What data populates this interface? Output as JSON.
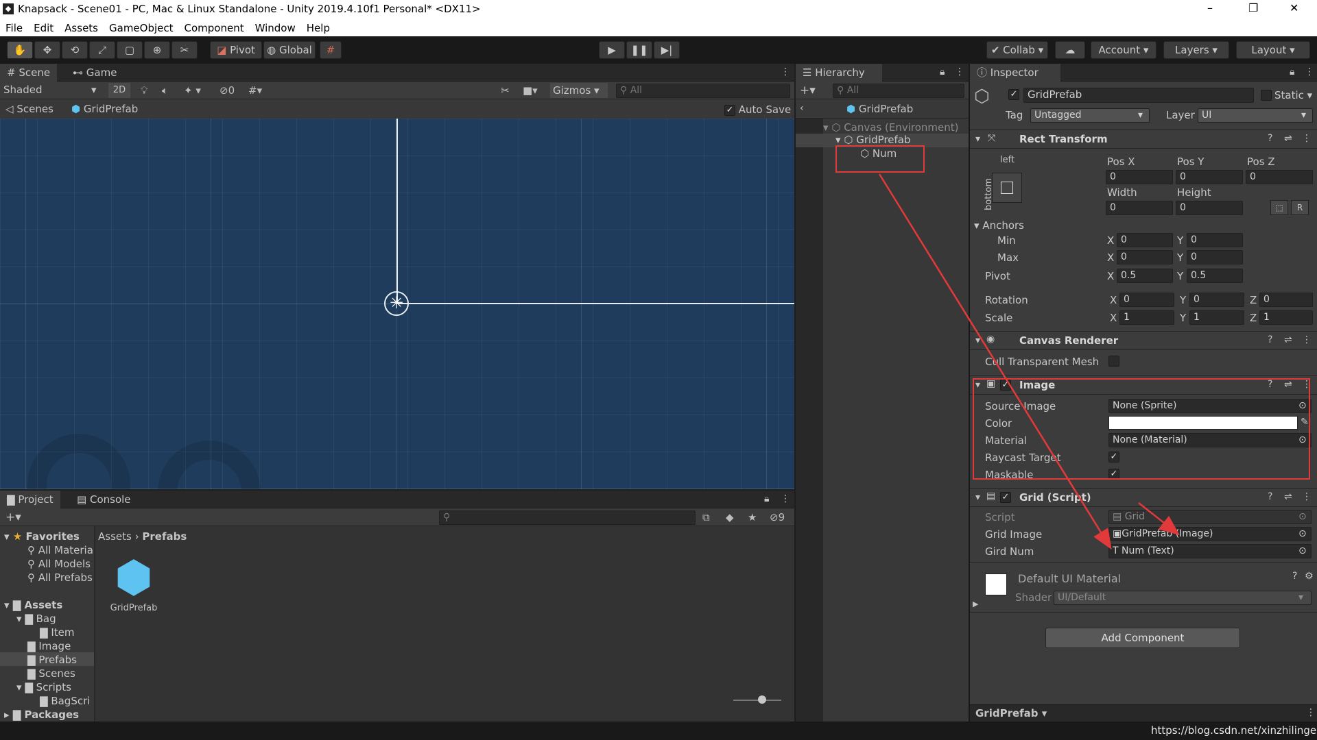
{
  "window": {
    "title": "Knapsack - Scene01 - PC, Mac & Linux Standalone - Unity 2019.4.10f1 Personal* <DX11>",
    "minimize": "–",
    "maximize": "❐",
    "close": "✕"
  },
  "menu": [
    "File",
    "Edit",
    "Assets",
    "GameObject",
    "Component",
    "Window",
    "Help"
  ],
  "toolbar": {
    "pivot": "Pivot",
    "global": "Global",
    "collab": "Collab",
    "account": "Account",
    "layers": "Layers",
    "layout": "Layout"
  },
  "scene": {
    "tab_scene": "Scene",
    "tab_game": "Game",
    "shading": "Shaded",
    "mode2d": "2D",
    "hidden_count": "0",
    "gizmos": "Gizmos",
    "search_placeholder": "All",
    "crumb_scenes": "Scenes",
    "crumb_prefab": "GridPrefab",
    "auto_save": "Auto Save"
  },
  "hierarchy": {
    "tab": "Hierarchy",
    "search_placeholder": "All",
    "prefab": "GridPrefab",
    "items": [
      "Canvas (Environment)",
      "GridPrefab",
      "Num"
    ]
  },
  "project": {
    "tab_project": "Project",
    "tab_console": "Console",
    "hidden_count": "9",
    "breadcrumb": [
      "Assets",
      "Prefabs"
    ],
    "favorites": {
      "label": "Favorites",
      "items": [
        "All Materia",
        "All Models",
        "All Prefabs"
      ]
    },
    "assets": {
      "label": "Assets",
      "items": [
        "Bag",
        "Item",
        "Image",
        "Prefabs",
        "Scenes",
        "Scripts",
        "BagScri"
      ]
    },
    "packages": "Packages",
    "asset_name": "GridPrefab"
  },
  "inspector": {
    "tab": "Inspector",
    "name": "GridPrefab",
    "static": "Static",
    "tag_label": "Tag",
    "tag": "Untagged",
    "layer_label": "Layer",
    "layer": "UI",
    "rect": {
      "title": "Rect Transform",
      "anchor_h": "left",
      "anchor_v": "bottom",
      "posx_l": "Pos X",
      "posy_l": "Pos Y",
      "posz_l": "Pos Z",
      "posx": "0",
      "posy": "0",
      "posz": "0",
      "width_l": "Width",
      "height_l": "Height",
      "width": "0",
      "height": "0",
      "r_btn": "R",
      "anchors": "Anchors",
      "min": "Min",
      "max": "Max",
      "pivot": "Pivot",
      "min_x": "0",
      "min_y": "0",
      "max_x": "0",
      "max_y": "0",
      "pivot_x": "0.5",
      "pivot_y": "0.5",
      "rotation": "Rotation",
      "scale": "Scale",
      "rot_x": "0",
      "rot_y": "0",
      "rot_z": "0",
      "sc_x": "1",
      "sc_y": "1",
      "sc_z": "1",
      "x": "X",
      "y": "Y",
      "z": "Z"
    },
    "canvas_renderer": {
      "title": "Canvas Renderer",
      "cull": "Cull Transparent Mesh"
    },
    "image": {
      "title": "Image",
      "source_l": "Source Image",
      "source": "None (Sprite)",
      "color_l": "Color",
      "material_l": "Material",
      "material": "None (Material)",
      "raycast_l": "Raycast Target",
      "maskable_l": "Maskable"
    },
    "grid": {
      "title": "Grid (Script)",
      "script_l": "Script",
      "script": "Grid",
      "image_l": "Grid Image",
      "image": "GridPrefab (Image)",
      "num_l": "Gird Num",
      "num": "Num (Text)"
    },
    "material": {
      "name": "Default UI Material",
      "shader_l": "Shader",
      "shader": "UI/Default"
    },
    "add_component": "Add Component",
    "footer": "GridPrefab"
  },
  "watermark": "https://blog.csdn.net/xinzhilinger",
  "colors": {
    "scene_bg": "#1f3c5c",
    "highlight": "#e23a3a",
    "prefab_blue": "#5ec3f0"
  }
}
